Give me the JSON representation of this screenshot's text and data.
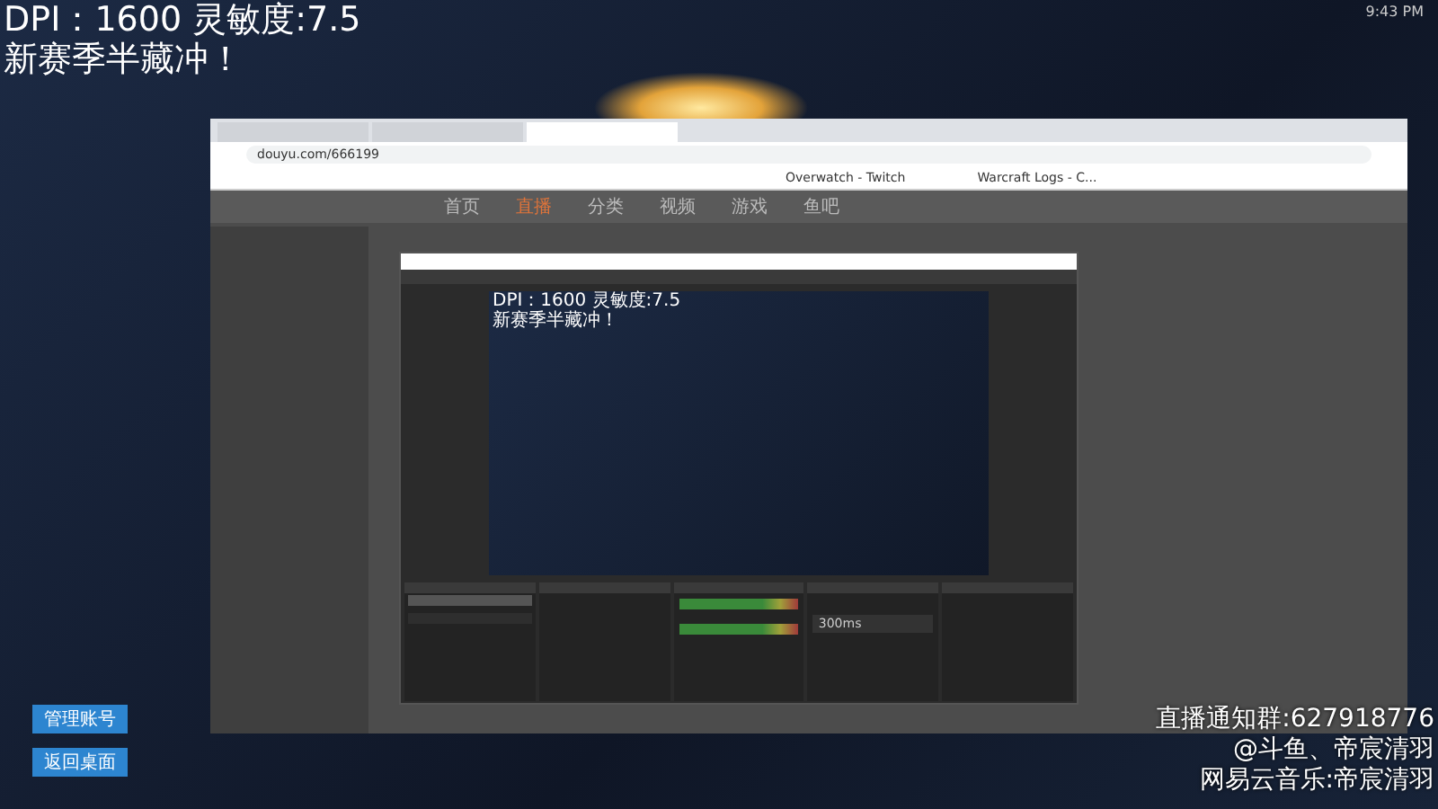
{
  "overlay": {
    "lines": [
      "DPI：1600 灵敏度:7.5",
      "新赛季半藏冲！"
    ]
  },
  "clock": "9:43 PM",
  "browser": {
    "tabs": [
      {
        "selected": false
      },
      {
        "selected": false
      },
      {
        "selected": true
      }
    ],
    "url": "douyu.com/666199",
    "bookmarks": [
      "Overwatch - Twitch",
      "Warcraft Logs - C..."
    ],
    "nav": [
      {
        "label": "首页",
        "selected": false
      },
      {
        "label": "直播",
        "selected": true
      },
      {
        "label": "分类",
        "selected": false
      },
      {
        "label": "视频",
        "selected": false
      },
      {
        "label": "游戏",
        "selected": false
      },
      {
        "label": "鱼吧",
        "selected": false
      }
    ]
  },
  "obs": {
    "preview_lines": [
      "DPI：1600 灵敏度:7.5",
      "新赛季半藏冲！"
    ],
    "scenes": [
      {
        "selected": true
      },
      {
        "selected": false
      }
    ],
    "transition": "300ms"
  },
  "buttons": [
    "管理账号",
    "返回桌面"
  ],
  "notice": [
    "直播通知群:627918776",
    "@斗鱼、帝宸清羽",
    "网易云音乐:帝宸清羽"
  ]
}
